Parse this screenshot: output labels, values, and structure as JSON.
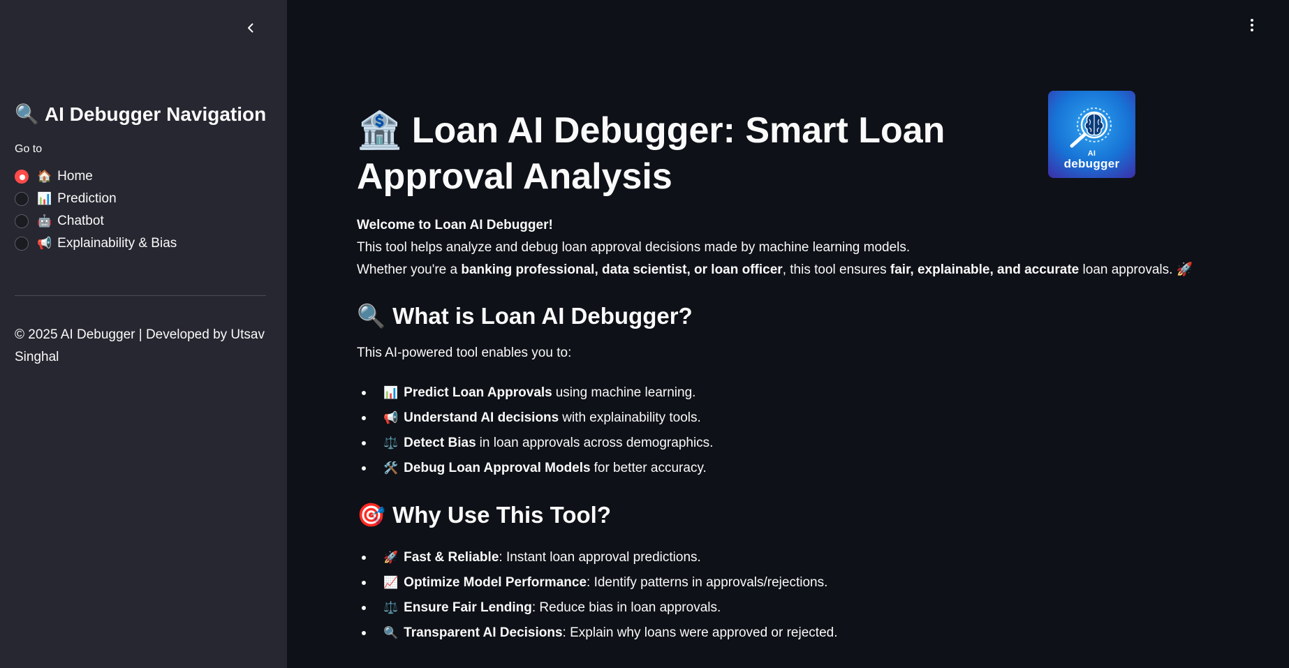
{
  "sidebar": {
    "title_emoji": "🔍",
    "title": "AI Debugger Navigation",
    "goto_label": "Go to",
    "nav_items": [
      {
        "emoji": "🏠",
        "label": "Home",
        "selected": true
      },
      {
        "emoji": "📊",
        "label": "Prediction",
        "selected": false
      },
      {
        "emoji": "🤖",
        "label": "Chatbot",
        "selected": false
      },
      {
        "emoji": "📢",
        "label": "Explainability & Bias",
        "selected": false
      }
    ],
    "footer": "© 2025 AI Debugger | Developed by Utsav Singhal"
  },
  "main": {
    "title_emoji": "🏦",
    "title": "Loan AI Debugger: Smart Loan Approval Analysis",
    "logo_text": "debugger",
    "logo_small": "AI",
    "intro": {
      "welcome": "Welcome to Loan AI Debugger!",
      "line1": "This tool helps analyze and debug loan approval decisions made by machine learning models.",
      "line2_a": "Whether you're a ",
      "line2_b": "banking professional, data scientist, or loan officer",
      "line2_c": ", this tool ensures ",
      "line2_d": "fair, explainable, and accurate",
      "line2_e": " loan approvals. 🚀"
    },
    "what_section": {
      "emoji": "🔍",
      "heading": "What is Loan AI Debugger?",
      "paragraph": "This AI-powered tool enables you to:",
      "items": [
        {
          "emoji": "📊",
          "bold": "Predict Loan Approvals",
          "text": "using machine learning."
        },
        {
          "emoji": "📢",
          "bold": "Understand AI decisions",
          "text": "with explainability tools."
        },
        {
          "emoji": "⚖️",
          "bold": "Detect Bias",
          "text": "in loan approvals across demographics."
        },
        {
          "emoji": "🛠️",
          "bold": "Debug Loan Approval Models",
          "text": "for better accuracy."
        }
      ]
    },
    "why_section": {
      "emoji": "🎯",
      "heading": "Why Use This Tool?",
      "items": [
        {
          "emoji": "🚀",
          "bold": "Fast & Reliable",
          "text": ": Instant loan approval predictions."
        },
        {
          "emoji": "📈",
          "bold": "Optimize Model Performance",
          "text": ": Identify patterns in approvals/rejections."
        },
        {
          "emoji": "⚖️",
          "bold": "Ensure Fair Lending",
          "text": ": Reduce bias in loan approvals."
        },
        {
          "emoji": "🔍",
          "bold": "Transparent AI Decisions",
          "text": ": Explain why loans were approved or rejected."
        }
      ]
    }
  },
  "colors": {
    "sidebar_bg": "#262730",
    "main_bg": "#0e1117",
    "accent": "#ff4b4b",
    "text": "#fafafa"
  }
}
